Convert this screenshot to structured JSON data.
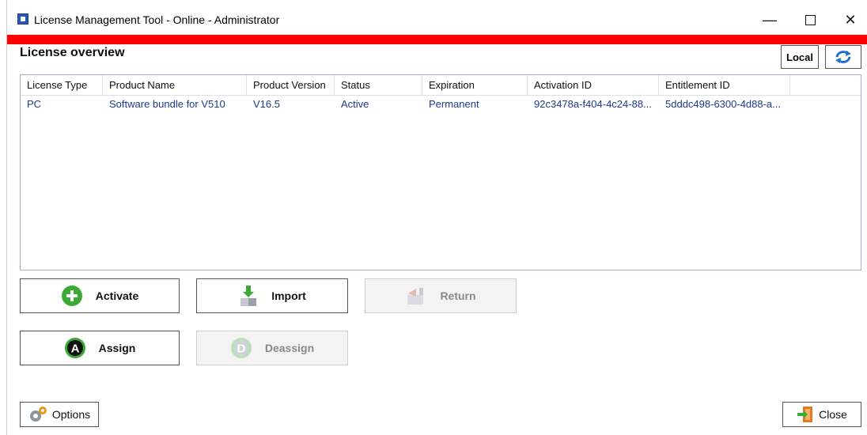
{
  "window": {
    "title": "License Management Tool - Online - Administrator"
  },
  "page": {
    "heading": "License overview"
  },
  "toolbar": {
    "local_label": "Local"
  },
  "table": {
    "columns": [
      "License Type",
      "Product Name",
      "Product Version",
      "Status",
      "Expiration",
      "Activation ID",
      "Entitlement ID"
    ],
    "rows": [
      {
        "license_type": "PC",
        "product_name": "Software bundle for V510",
        "product_version": "V16.5",
        "status": "Active",
        "expiration": "Permanent",
        "activation_id": "92c3478a-f404-4c24-88...",
        "entitlement_id": "5dddc498-6300-4d88-a..."
      }
    ]
  },
  "actions": {
    "activate": "Activate",
    "import": "Import",
    "return": "Return",
    "assign": "Assign",
    "deassign": "Deassign"
  },
  "footer": {
    "options": "Options",
    "close": "Close"
  },
  "colors": {
    "banner": "#ff0000",
    "link_text": "#1a3c8c",
    "green": "#3aa935",
    "blue_icon": "#1f6fd1"
  }
}
